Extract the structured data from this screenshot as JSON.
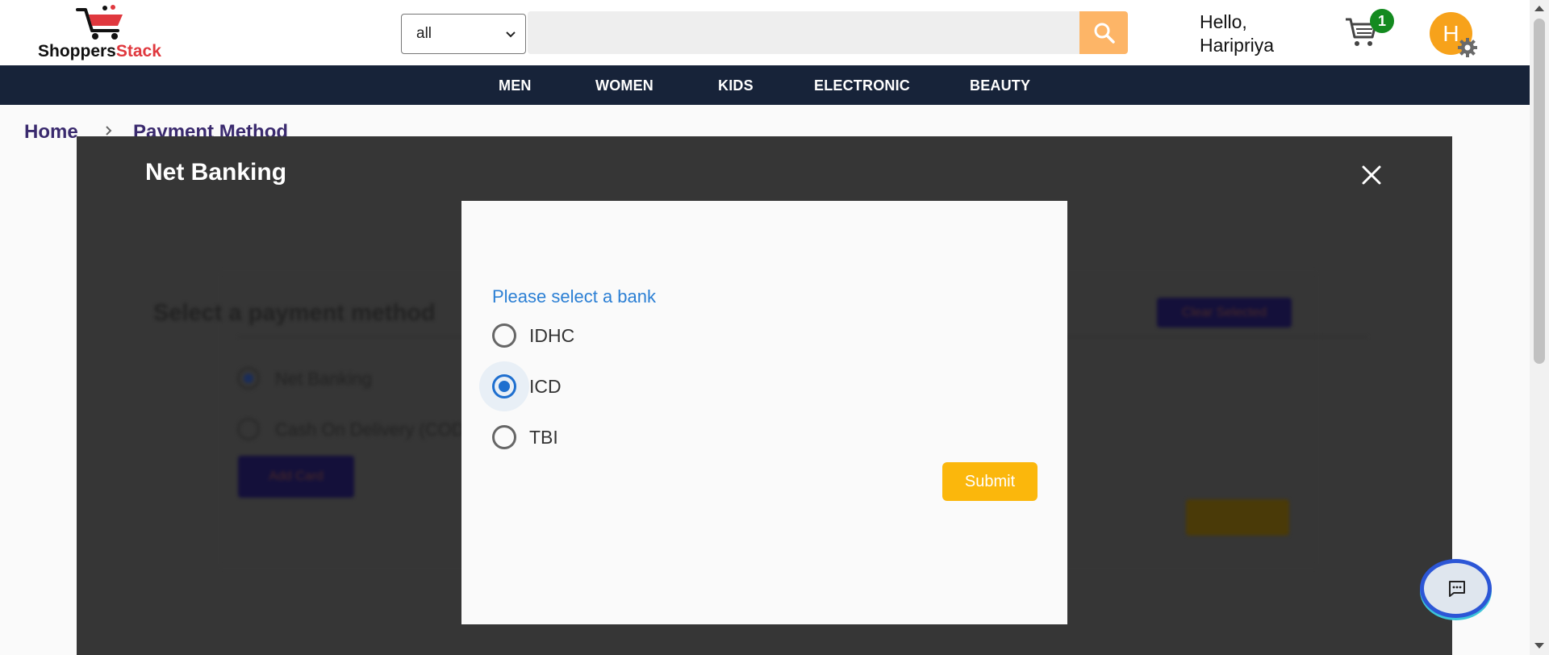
{
  "header": {
    "logo": {
      "text_main": "Shoppers",
      "text_accent": "Stack"
    },
    "category_select": {
      "value": "all"
    },
    "search": {
      "placeholder": ""
    },
    "greeting_line1": "Hello,",
    "greeting_line2": "Haripriya",
    "cart_count": "1",
    "avatar_initial": "H"
  },
  "nav": {
    "items": [
      "MEN",
      "WOMEN",
      "KIDS",
      "ELECTRONIC",
      "BEAUTY"
    ]
  },
  "breadcrumb": {
    "home": "Home",
    "current": "Payment Method"
  },
  "overlay": {
    "title": "Net Banking",
    "background": {
      "title": "Select a payment method",
      "clear_label": "Clear Selected",
      "options": [
        "Net Banking",
        "Cash On Delivery (COD)"
      ],
      "selected_option": "Net Banking",
      "add_button": "Add Card"
    }
  },
  "modal": {
    "prompt": "Please select a bank",
    "banks": [
      "IDHC",
      "ICD",
      "TBI"
    ],
    "selected": "ICD",
    "submit_label": "Submit"
  },
  "colors": {
    "nav_bg": "#172339",
    "accent_orange": "#fdb567",
    "submit_yellow": "#fbb70c",
    "link_blue": "#2b7fd4",
    "cart_badge_green": "#138a1f",
    "avatar_orange": "#f7a21b"
  },
  "icons": {
    "search": "search-icon",
    "cart": "cart-icon",
    "settings": "gear-icon",
    "close": "close-icon",
    "chat": "chat-icon",
    "breadcrumb_separator": "chevron-right-icon",
    "select_chevron": "chevron-down-icon"
  }
}
